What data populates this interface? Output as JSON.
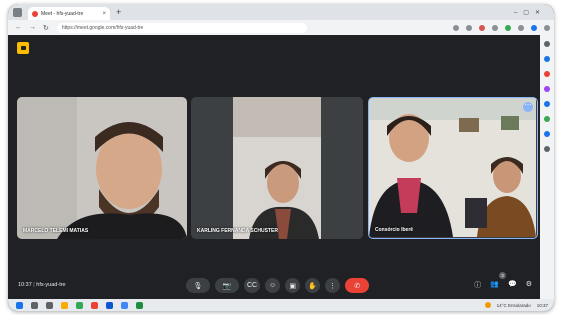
{
  "browser": {
    "tab_title": "Meet - hfs-yuad-tre",
    "url": "https://meet.google.com/hfs-yuad-tre",
    "new_tab": "+",
    "tab_close": "×",
    "nav_back": "←",
    "nav_forward": "→",
    "nav_reload": "↻",
    "window_controls": "–▢✕"
  },
  "meet": {
    "participants": [
      {
        "name": "MARCELO TELEMI MATIAS"
      },
      {
        "name": "KARLING FERNANDA SCHUSTER"
      },
      {
        "name": "Consórcio Iberê"
      }
    ],
    "time": "10:37",
    "meeting_code": "hfs-yuad-tre",
    "participant_count": "3",
    "controls": {
      "mic": "🎙",
      "camera": "📷",
      "captions": "CC",
      "emoji": "☺",
      "present": "▣",
      "raise_hand": "✋",
      "more": "⋮",
      "end_call": "✆"
    },
    "right_controls": {
      "info": "ⓘ",
      "people": "👥",
      "chat": "💬",
      "activities": "⚙"
    }
  },
  "taskbar": {
    "weather": "14°C Ensolarado",
    "clock": "10:37"
  },
  "colors": {
    "meet_bg": "#202124",
    "tile_bg": "#3c4043",
    "active_border": "#8ab4f8",
    "end_call": "#ea4335",
    "logo": "#fbbc04"
  }
}
